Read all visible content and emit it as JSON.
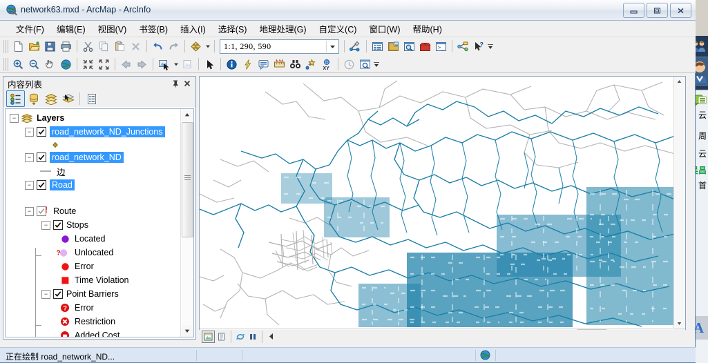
{
  "window": {
    "title": "network63.mxd - ArcMap - ArcInfo",
    "app_icon": "arcmap-globe-icon",
    "minimize_label": "–",
    "restore_label": "□",
    "close_label": "✕"
  },
  "menu": {
    "items": [
      {
        "label": "文件(F)",
        "name": "menu-file"
      },
      {
        "label": "编辑(E)",
        "name": "menu-edit"
      },
      {
        "label": "视图(V)",
        "name": "menu-view"
      },
      {
        "label": "书签(B)",
        "name": "menu-bookmarks"
      },
      {
        "label": "插入(I)",
        "name": "menu-insert"
      },
      {
        "label": "选择(S)",
        "name": "menu-selection"
      },
      {
        "label": "地理处理(G)",
        "name": "menu-geoprocessing"
      },
      {
        "label": "自定义(C)",
        "name": "menu-customize"
      },
      {
        "label": "窗口(W)",
        "name": "menu-windows"
      },
      {
        "label": "帮助(H)",
        "name": "menu-help"
      }
    ]
  },
  "toolbar_standard": {
    "scale": "1:1, 290, 590",
    "buttons": [
      "new-document-icon",
      "open-folder-icon",
      "save-icon",
      "print-icon",
      "cut-scissors-icon",
      "copy-icon",
      "paste-icon",
      "delete-x-icon",
      "undo-arrow-icon",
      "redo-arrow-icon",
      "add-data-icon",
      "editor-toolbar-icon",
      "table-of-contents-icon",
      "catalog-window-icon",
      "search-window-icon",
      "arctoolbox-icon",
      "python-window-icon",
      "model-builder-icon",
      "help-pointer-icon"
    ]
  },
  "toolbar_tools": {
    "buttons": [
      "zoom-in-icon",
      "zoom-out-icon",
      "pan-hand-icon",
      "full-extent-globe-icon",
      "fixed-zoom-in-icon",
      "fixed-zoom-out-icon",
      "go-back-extent-icon",
      "go-forward-extent-icon",
      "select-features-icon",
      "clear-selection-icon",
      "select-elements-arrow-icon",
      "identify-info-icon",
      "hyperlink-lightning-icon",
      "html-popup-icon",
      "measure-ruler-icon",
      "find-binoculars-icon",
      "find-route-icon",
      "go-to-xy-icon",
      "time-slider-icon",
      "create-viewer-window-icon"
    ]
  },
  "toc": {
    "title": "内容列表",
    "pin_icon": "pin-icon",
    "close_icon": "close-icon",
    "tools": [
      {
        "name": "list-by-drawing-order-icon",
        "active": true
      },
      {
        "name": "list-by-source-icon",
        "active": false
      },
      {
        "name": "list-by-visibility-icon",
        "active": false
      },
      {
        "name": "list-by-selection-icon",
        "active": false
      },
      {
        "name": "toc-options-icon",
        "active": false
      }
    ],
    "tree": [
      {
        "label": "Layers",
        "type": "root",
        "expander": "-",
        "icon": "layers-stack-icon",
        "bold": true,
        "indent": 0
      },
      {
        "label": "road_network_ND_Junctions",
        "type": "layer",
        "expander": "-",
        "checked": true,
        "selected": true,
        "indent": 1
      },
      {
        "label": "",
        "type": "symbol",
        "symbol": "junction-point-symbol",
        "indent": 3
      },
      {
        "label": "road_network_ND",
        "type": "layer",
        "expander": "-",
        "checked": true,
        "selected": true,
        "indent": 1
      },
      {
        "label": "边",
        "type": "symbol-label",
        "symbol": "edge-line-symbol",
        "indent": 2
      },
      {
        "label": "Road",
        "type": "layer",
        "expander": "-",
        "checked": true,
        "selected": true,
        "indent": 1
      },
      {
        "label": "Route",
        "type": "group",
        "expander": "-",
        "checked": true,
        "warning": true,
        "indent": 1
      },
      {
        "label": "Stops",
        "type": "group",
        "expander": "-",
        "checked": true,
        "indent": 2
      },
      {
        "label": "Located",
        "type": "symbol-label",
        "symbol": "purple-circle-symbol",
        "indent": 3
      },
      {
        "label": "Unlocated",
        "type": "symbol-label",
        "symbol": "unlocated-question-symbol",
        "indent": 3
      },
      {
        "label": "Error",
        "type": "symbol-label",
        "symbol": "red-circle-symbol",
        "indent": 3
      },
      {
        "label": "Time Violation",
        "type": "symbol-label",
        "symbol": "red-square-symbol",
        "indent": 3
      },
      {
        "label": "Point Barriers",
        "type": "group",
        "expander": "-",
        "checked": true,
        "indent": 2
      },
      {
        "label": "Error",
        "type": "symbol-label",
        "symbol": "red-question-badge-icon",
        "indent": 3
      },
      {
        "label": "Restriction",
        "type": "symbol-label",
        "symbol": "red-x-badge-icon",
        "indent": 3
      },
      {
        "label": "Added Cost",
        "type": "symbol-label",
        "symbol": "red-ring-badge-icon",
        "indent": 3
      }
    ]
  },
  "map": {
    "layer_colors": {
      "network_teal": "#1a7fa8",
      "road_gray": "#b3b3b3",
      "background": "#ffffff"
    },
    "view_buttons": [
      {
        "name": "data-view-button",
        "active": true
      },
      {
        "name": "layout-view-button",
        "active": false
      },
      {
        "name": "refresh-view-button",
        "active": false
      },
      {
        "name": "pause-drawing-button",
        "active": false
      },
      {
        "name": "previous-extent-button",
        "active": false
      }
    ]
  },
  "status": {
    "text": "正在绘制 road_network_ND...",
    "globe_icon": "globe-icon"
  },
  "chat_panel": {
    "avatar_group_icon": "contacts-group-icon",
    "avatar_icon": "user-avatar-icon",
    "message_icon": "message-bubble-icon",
    "lines": [
      "云",
      "周",
      "云",
      "吴昌",
      "首"
    ],
    "highlight_color": "#1a9e4b",
    "letter_icon": "A"
  }
}
